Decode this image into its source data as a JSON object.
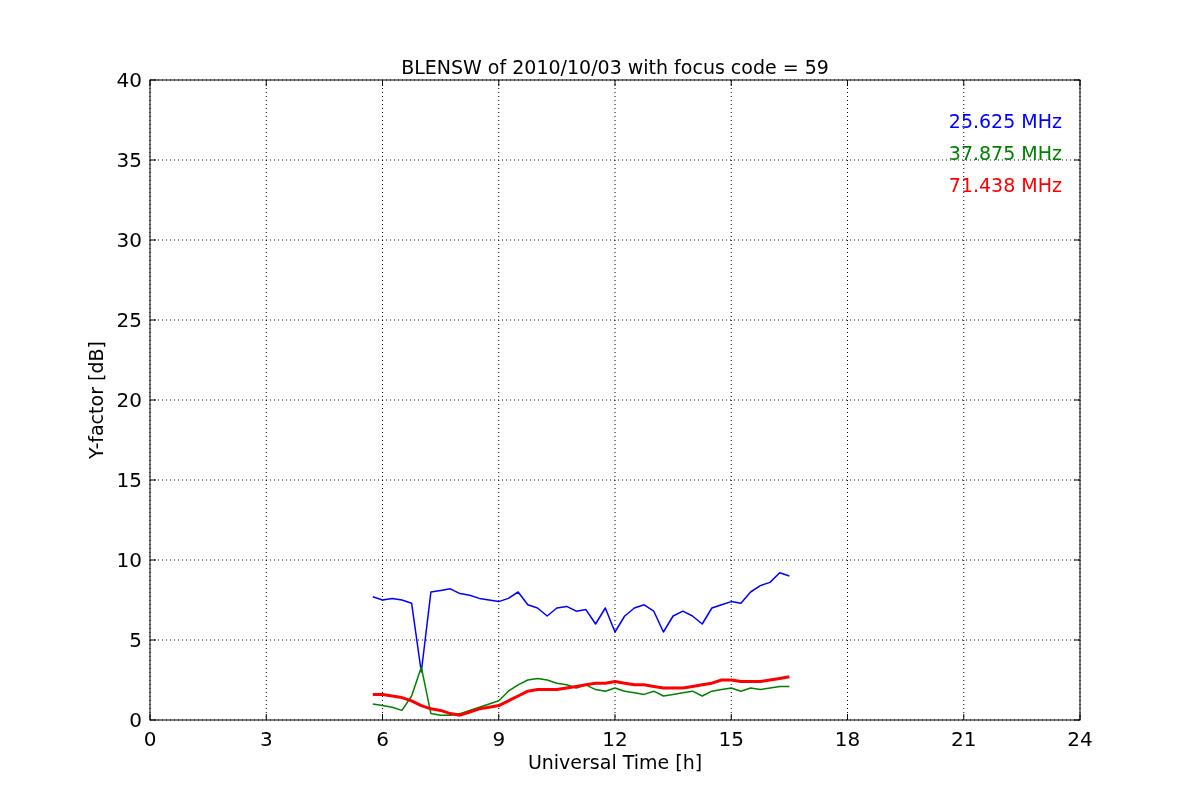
{
  "chart_data": {
    "type": "line",
    "grid": true,
    "title": "BLENSW of 2010/10/03 with focus code = 59",
    "xlabel": "Universal Time [h]",
    "ylabel": "Y-factor [dB]",
    "xlim": [
      0,
      24
    ],
    "ylim": [
      0,
      40
    ],
    "xticks": [
      0,
      3,
      6,
      9,
      12,
      15,
      18,
      21,
      24
    ],
    "yticks": [
      0,
      5,
      10,
      15,
      20,
      25,
      30,
      35,
      40
    ],
    "x": [
      5.75,
      6,
      6.25,
      6.5,
      6.75,
      7,
      7.25,
      7.5,
      7.75,
      8,
      8.25,
      8.5,
      8.75,
      9,
      9.25,
      9.5,
      9.75,
      10,
      10.25,
      10.5,
      10.75,
      11,
      11.25,
      11.5,
      11.75,
      12,
      12.25,
      12.5,
      12.75,
      13,
      13.25,
      13.5,
      13.75,
      14,
      14.25,
      14.5,
      14.75,
      15,
      15.25,
      15.5,
      15.75,
      16,
      16.25,
      16.5
    ],
    "series": [
      {
        "name": "25.625 MHz",
        "color": "#0000ff",
        "values": [
          7.7,
          7.5,
          7.6,
          7.5,
          7.3,
          3,
          8,
          8.1,
          8.2,
          7.9,
          7.8,
          7.6,
          7.5,
          7.4,
          7.6,
          8,
          7.2,
          7,
          6.5,
          7,
          7.1,
          6.8,
          6.9,
          6,
          7,
          5.5,
          6.5,
          7,
          7.2,
          6.8,
          5.5,
          6.5,
          6.8,
          6.5,
          6,
          7,
          7.2,
          7.4,
          7.3,
          8,
          8.4,
          8.6,
          9.2,
          9
        ]
      },
      {
        "name": "37.875 MHz",
        "color": "#008000",
        "values": [
          1,
          0.9,
          0.8,
          0.6,
          1.5,
          3.3,
          0.4,
          0.3,
          0.3,
          0.4,
          0.6,
          0.8,
          1,
          1.2,
          1.8,
          2.2,
          2.5,
          2.6,
          2.5,
          2.3,
          2.2,
          2,
          2.2,
          1.9,
          1.8,
          2,
          1.8,
          1.7,
          1.6,
          1.8,
          1.5,
          1.6,
          1.7,
          1.8,
          1.5,
          1.8,
          1.9,
          2,
          1.8,
          2,
          1.9,
          2,
          2.1,
          2.1
        ]
      },
      {
        "name": "71.438 MHz",
        "color": "#ff0000",
        "values": [
          1.6,
          1.6,
          1.5,
          1.4,
          1.2,
          0.9,
          0.7,
          0.6,
          0.4,
          0.3,
          0.5,
          0.7,
          0.8,
          0.9,
          1.2,
          1.5,
          1.8,
          1.9,
          1.9,
          1.9,
          2,
          2.1,
          2.2,
          2.3,
          2.3,
          2.4,
          2.3,
          2.2,
          2.2,
          2.1,
          2,
          2,
          2,
          2.1,
          2.2,
          2.3,
          2.5,
          2.5,
          2.4,
          2.4,
          2.4,
          2.5,
          2.6,
          2.7
        ]
      }
    ]
  }
}
